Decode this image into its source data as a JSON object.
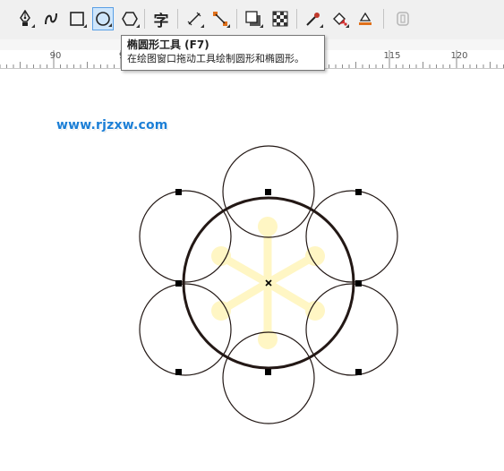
{
  "toolbar": {
    "tools": [
      {
        "name": "pen-tool-icon",
        "selected": false
      },
      {
        "name": "artistic-media-tool-icon",
        "selected": false
      },
      {
        "name": "rectangle-tool-icon",
        "selected": false
      },
      {
        "name": "ellipse-tool-icon",
        "selected": true
      },
      {
        "name": "polygon-tool-icon",
        "selected": false
      },
      {
        "name": "text-tool-icon",
        "selected": false
      },
      {
        "name": "dimension-tool-icon",
        "selected": false
      },
      {
        "name": "connector-tool-icon",
        "selected": false
      },
      {
        "name": "drop-shadow-tool-icon",
        "selected": false
      },
      {
        "name": "transparency-tool-icon",
        "selected": false
      },
      {
        "name": "eyedropper-tool-icon",
        "selected": false
      },
      {
        "name": "interactive-fill-tool-icon",
        "selected": false
      },
      {
        "name": "smart-fill-tool-icon",
        "selected": false
      },
      {
        "name": "object-options-icon",
        "selected": false
      }
    ],
    "text_tool_glyph": "字"
  },
  "ruler": {
    "labels": [
      "90",
      "9",
      "115",
      "120"
    ]
  },
  "tooltip": {
    "title": "椭圆形工具 (F7)",
    "description": "在绘图窗口拖动工具绘制圆形和椭圆形。"
  },
  "watermark": {
    "text": "www.rjzxw.com"
  },
  "colors": {
    "selected_tool_bg": "#cfe6fb",
    "selected_tool_border": "#5aa0e6",
    "watermark": "#1c7fd6",
    "center_circle_stroke": "#231815",
    "guide_shape": "#fff8c8"
  }
}
